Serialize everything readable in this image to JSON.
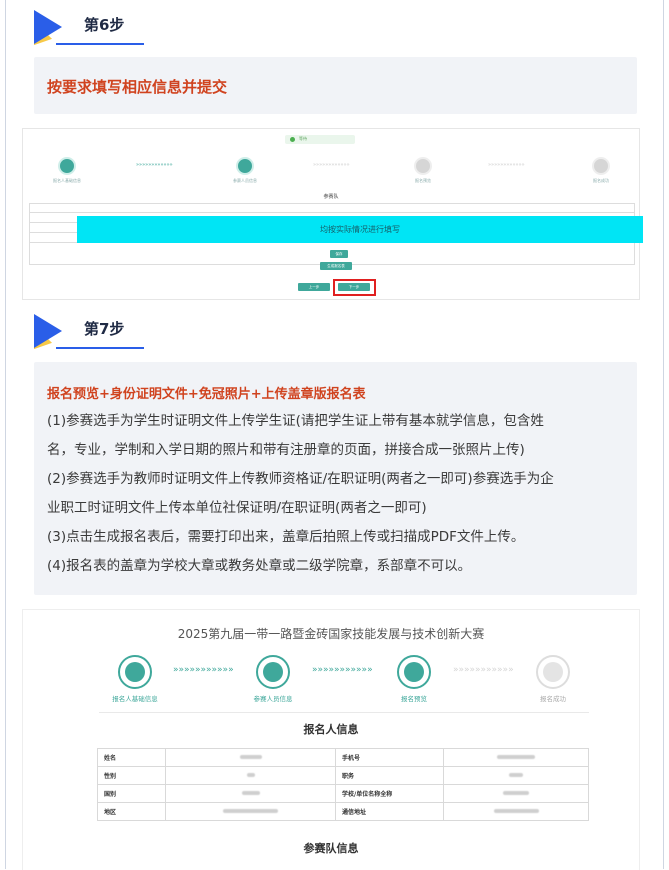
{
  "step6": {
    "title": "第6步",
    "instruction": "按要求填写相应信息并提交"
  },
  "shot1": {
    "status_text": "等待",
    "steps": [
      "报名人基础信息",
      "参赛人员信息",
      "报名预览",
      "报名成功"
    ],
    "table_title": "参赛队",
    "overlay_text": "均按实际情况进行填写",
    "buttons": {
      "save": "保存",
      "generate": "生成报名表",
      "prev": "上一步",
      "next": "下一步"
    }
  },
  "step7": {
    "title": "第7步",
    "heading": "报名预览+身份证明文件+免冠照片+上传盖章版报名表",
    "paragraphs": [
      "(1)参赛选手为学生时证明文件上传学生证(请把学生证上带有基本就学信息，包含姓",
      "名，专业，学制和入学日期的照片和带有注册章的页面，拼接合成一张照片上传)",
      "(2)参赛选手为教师时证明文件上传教师资格证/在职证明(两者之一即可)参赛选手为企",
      "业职工时证明文件上传本单位社保证明/在职证明(两者之一即可)",
      "(3)点击生成报名表后，需要打印出来，盖章后拍照上传或扫描成PDF文件上传。",
      "(4)报名表的盖章为学校大章或教务处章或二级学院章，系部章不可以。"
    ]
  },
  "shot3": {
    "competition_title": "2025第九届一带一路暨金砖国家技能发展与技术创新大赛",
    "steps": [
      "报名人基础信息",
      "参赛人员信息",
      "报名预览",
      "报名成功"
    ],
    "section1_title": "报名人信息",
    "rows": [
      {
        "k1": "姓名",
        "k2": "手机号"
      },
      {
        "k1": "性别",
        "k2": "职务"
      },
      {
        "k1": "国别",
        "k2": "学校/单位名称全称"
      },
      {
        "k1": "地区",
        "k2": "通信地址"
      }
    ],
    "section2_title": "参赛队信息"
  },
  "colors": {
    "accent_blue": "#2a5ee8",
    "accent_yellow": "#f7c948",
    "heading_red": "#d0431f",
    "teal": "#3fa89b",
    "overlay_cyan": "#00e5f5",
    "highlight_red": "#e02020"
  }
}
